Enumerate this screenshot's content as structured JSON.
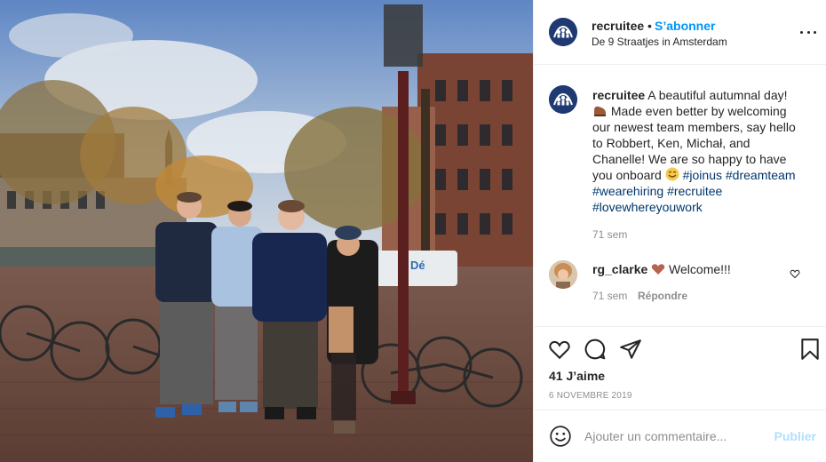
{
  "post": {
    "username": "recruitee",
    "follow_label": "S’abonner",
    "location": "De 9 Straatjes in Amsterdam",
    "caption": {
      "username": "recruitee",
      "text_1": " A beautiful autumnal day! ",
      "text_2": " Made even better by welcoming our newest team members, say hello to Robbert, Ken, Michał, and Chanelle! We are so happy to have you onboard ",
      "hashtags": [
        "#joinus",
        "#dreamteam",
        "#wearehiring",
        "#recruitee",
        "#lovewhereyouwork"
      ],
      "time": "71 sem"
    },
    "comments": [
      {
        "username": "rg_clarke",
        "text": " Welcome!!!",
        "time": "71 sem",
        "reply_label": "Répondre"
      }
    ],
    "likes_text": "41 J’aime",
    "date": "6 NOVEMBRE 2019",
    "add_comment_placeholder": "Ajouter un commentaire...",
    "publish_label": "Publier",
    "photo_sign": "Dé"
  },
  "colors": {
    "accent": "#0095f6",
    "hashtag": "#00376b",
    "heart": "#b6644f",
    "brand": "#1f3a73"
  },
  "icons": [
    "more-icon",
    "heart-icon",
    "comment-icon",
    "share-icon",
    "bookmark-icon",
    "smile-icon",
    "emoji-boot",
    "emoji-smile",
    "emoji-heart"
  ]
}
